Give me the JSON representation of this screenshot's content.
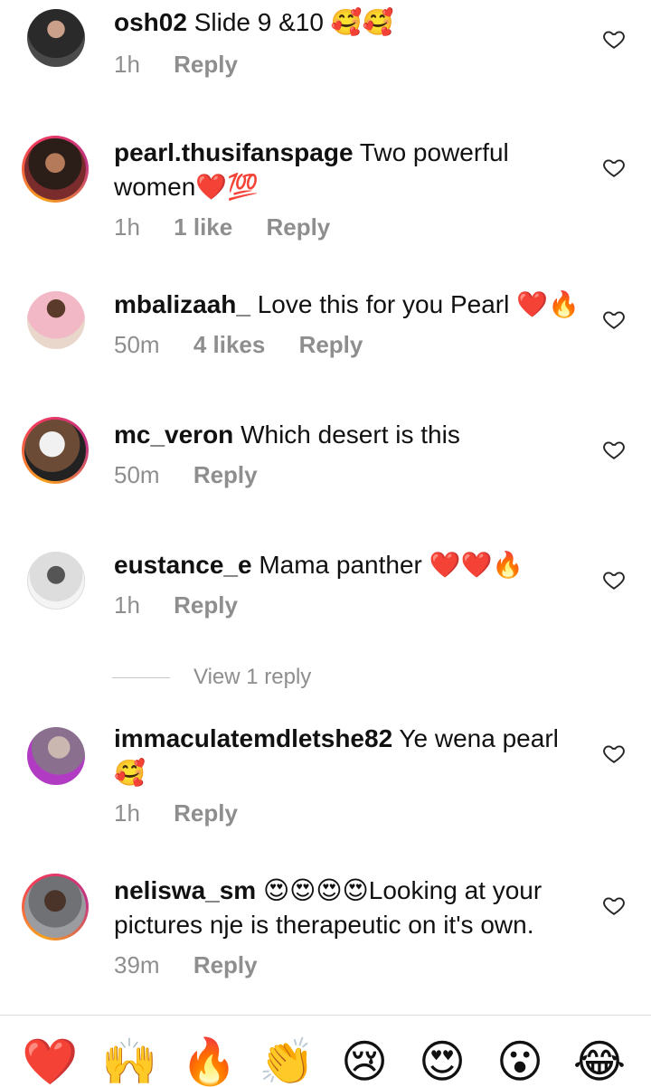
{
  "comments": [
    {
      "username": "osh02",
      "text": "Slide 9 &10 🥰🥰",
      "time": "1h",
      "likes": "",
      "reply": "Reply"
    },
    {
      "username": "pearl.thusifanspage",
      "text": "Two powerful women❤️💯",
      "time": "1h",
      "likes": "1 like",
      "reply": "Reply"
    },
    {
      "username": "mbalizaah_",
      "text": "Love this for you Pearl ❤️🔥",
      "time": "50m",
      "likes": "4 likes",
      "reply": "Reply"
    },
    {
      "username": "mc_veron",
      "text": "Which desert is this",
      "time": "50m",
      "likes": "",
      "reply": "Reply"
    },
    {
      "username": "eustance_e",
      "text": "Mama panther ❤️❤️🔥",
      "time": "1h",
      "likes": "",
      "reply": "Reply"
    },
    {
      "username": "immaculatemdletshe82",
      "text": "Ye wena pearl🥰",
      "time": "1h",
      "likes": "",
      "reply": "Reply"
    },
    {
      "username": "neliswa_sm",
      "text": "😍😍😍😍Looking at your pictures nje is therapeutic on it's own.",
      "time": "39m",
      "likes": "",
      "reply": "Reply"
    }
  ],
  "view_replies": "View 1 reply",
  "emoji_bar": [
    "❤️",
    "🙌",
    "🔥",
    "👏",
    "😢",
    "😍",
    "😮",
    "😂"
  ],
  "icons": {
    "like": "heart-outline-icon"
  },
  "colors": {
    "meta": "#8e8e8e",
    "ring_start": "#f9a11b",
    "ring_end": "#c13584"
  }
}
